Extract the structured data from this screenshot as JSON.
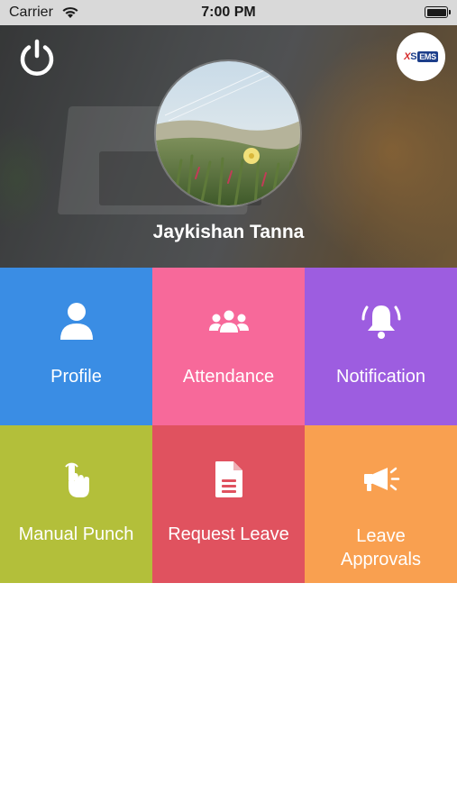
{
  "status_bar": {
    "carrier": "Carrier",
    "time": "7:00 PM"
  },
  "header": {
    "user_name": "Jaykishan Tanna",
    "logo": {
      "part1": "X",
      "part2": "S",
      "part3": "EMS"
    },
    "power_icon": "power-icon"
  },
  "menu": {
    "tiles": [
      {
        "label": "Profile",
        "icon": "person-icon",
        "color": "#3a8de4"
      },
      {
        "label": "Attendance",
        "icon": "group-icon",
        "color": "#f7699a"
      },
      {
        "label": "Notification",
        "icon": "bell-icon",
        "color": "#9d5de0"
      },
      {
        "label": "Manual Punch",
        "icon": "tap-hand-icon",
        "color": "#b3bf3a"
      },
      {
        "label": "Request Leave",
        "icon": "document-icon",
        "color": "#e0525f"
      },
      {
        "label": "Leave\nApprovals",
        "icon": "megaphone-icon",
        "color": "#f9a050"
      }
    ]
  }
}
